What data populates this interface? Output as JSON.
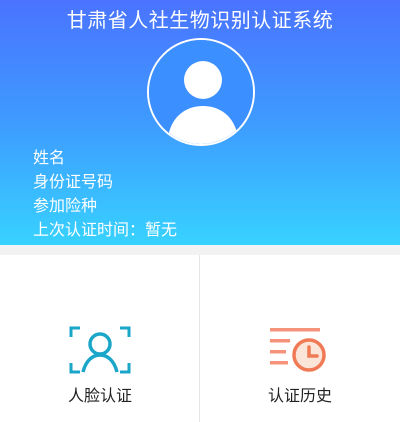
{
  "header": {
    "title": "甘肃省人社生物识别认证系统",
    "avatar_icon": "user-avatar-icon"
  },
  "profile": {
    "name_label": "姓名",
    "id_label": "身份证号码",
    "insurance_label": "参加险种",
    "last_auth_label": "上次认证时间：暂无"
  },
  "actions": {
    "face_auth": {
      "label": "人脸认证",
      "icon": "face-scan-icon",
      "color": "#1aa6c9"
    },
    "auth_history": {
      "label": "认证历史",
      "icon": "history-clock-icon",
      "color": "#f07a55"
    }
  },
  "colors": {
    "header_top": "#4a73ff",
    "header_bottom": "#37d2ff"
  }
}
